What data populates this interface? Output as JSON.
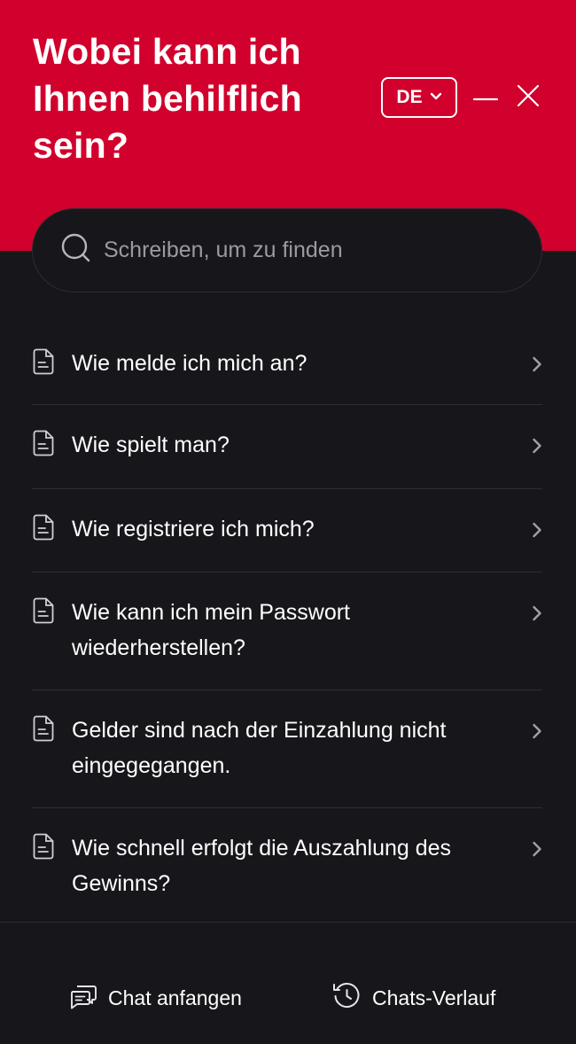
{
  "header": {
    "title": "Wobei kann ich Ihnen behilflich sein?",
    "language": "DE",
    "colors": {
      "brand": "#d1002c",
      "background": "#17171b"
    },
    "icons": [
      "chevron-down-icon",
      "minimize-icon",
      "close-icon"
    ]
  },
  "search": {
    "placeholder": "Schreiben, um zu finden",
    "value": "",
    "icon": "search-icon"
  },
  "faq": {
    "items": [
      {
        "label": "Wie melde ich mich an?"
      },
      {
        "label": "Wie spielt man?"
      },
      {
        "label": "Wie registriere ich mich?"
      },
      {
        "label": "Wie kann ich mein Passwort wiederherstellen?"
      },
      {
        "label": "Gelder sind nach der Einzahlung nicht eingegegangen."
      },
      {
        "label": "Wie schnell erfolgt die Auszahlung des Gewinns?"
      }
    ]
  },
  "footer": {
    "start_chat": "Chat anfangen",
    "history": "Chats-Verlauf"
  }
}
